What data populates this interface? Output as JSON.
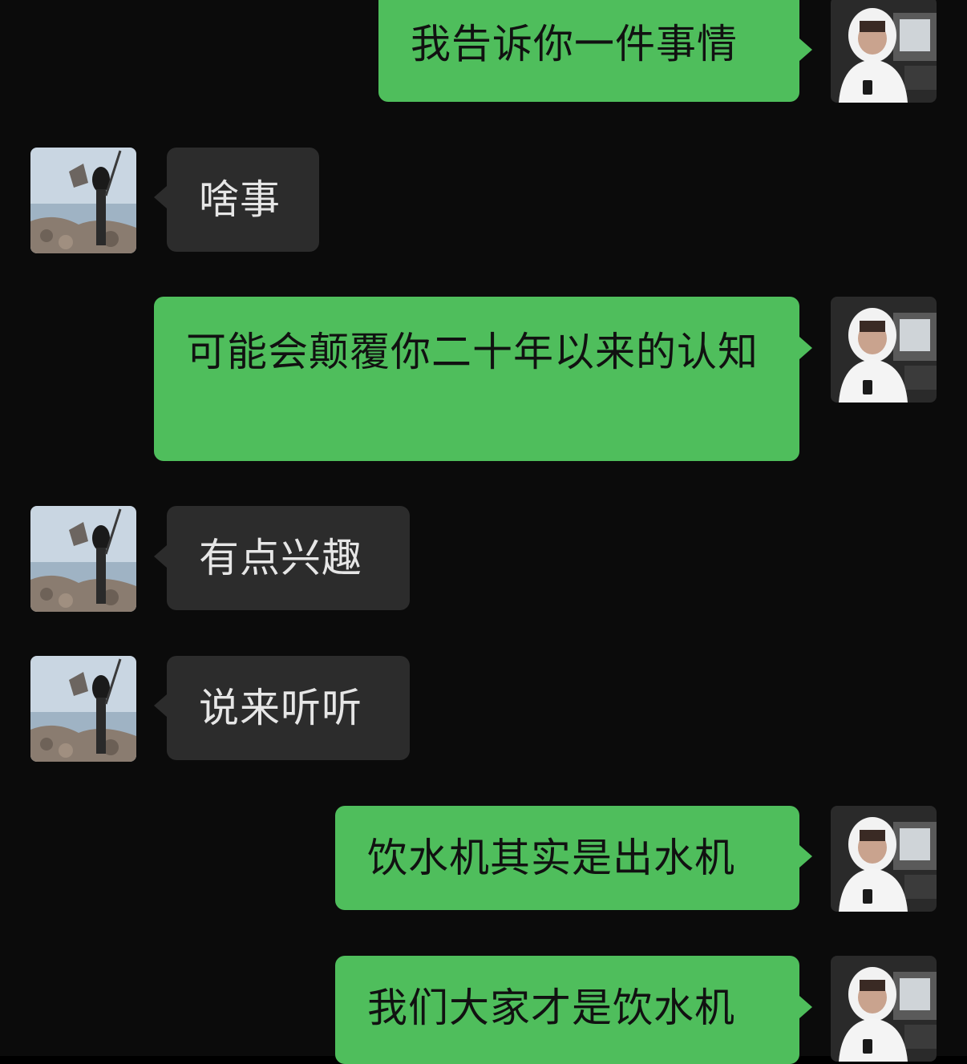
{
  "conversation": {
    "messages": [
      {
        "sender": "self",
        "text": "我告诉你一件事情"
      },
      {
        "sender": "contact",
        "text": "啥事"
      },
      {
        "sender": "self",
        "text": "可能会颠覆你二十年以来的认知"
      },
      {
        "sender": "contact",
        "text": "有点兴趣"
      },
      {
        "sender": "contact",
        "text": "说来听听"
      },
      {
        "sender": "self",
        "text": "饮水机其实是出水机"
      },
      {
        "sender": "self",
        "text": "我们大家才是饮水机"
      }
    ]
  },
  "avatars": {
    "self": "hooded-person-avatar-icon",
    "contact": "seaside-person-avatar-icon"
  },
  "colors": {
    "background": "#0b0b0b",
    "outgoing_bubble": "#4fbe5c",
    "incoming_bubble": "#2c2c2c",
    "incoming_text": "#e6e6e6",
    "outgoing_text": "#111111"
  }
}
